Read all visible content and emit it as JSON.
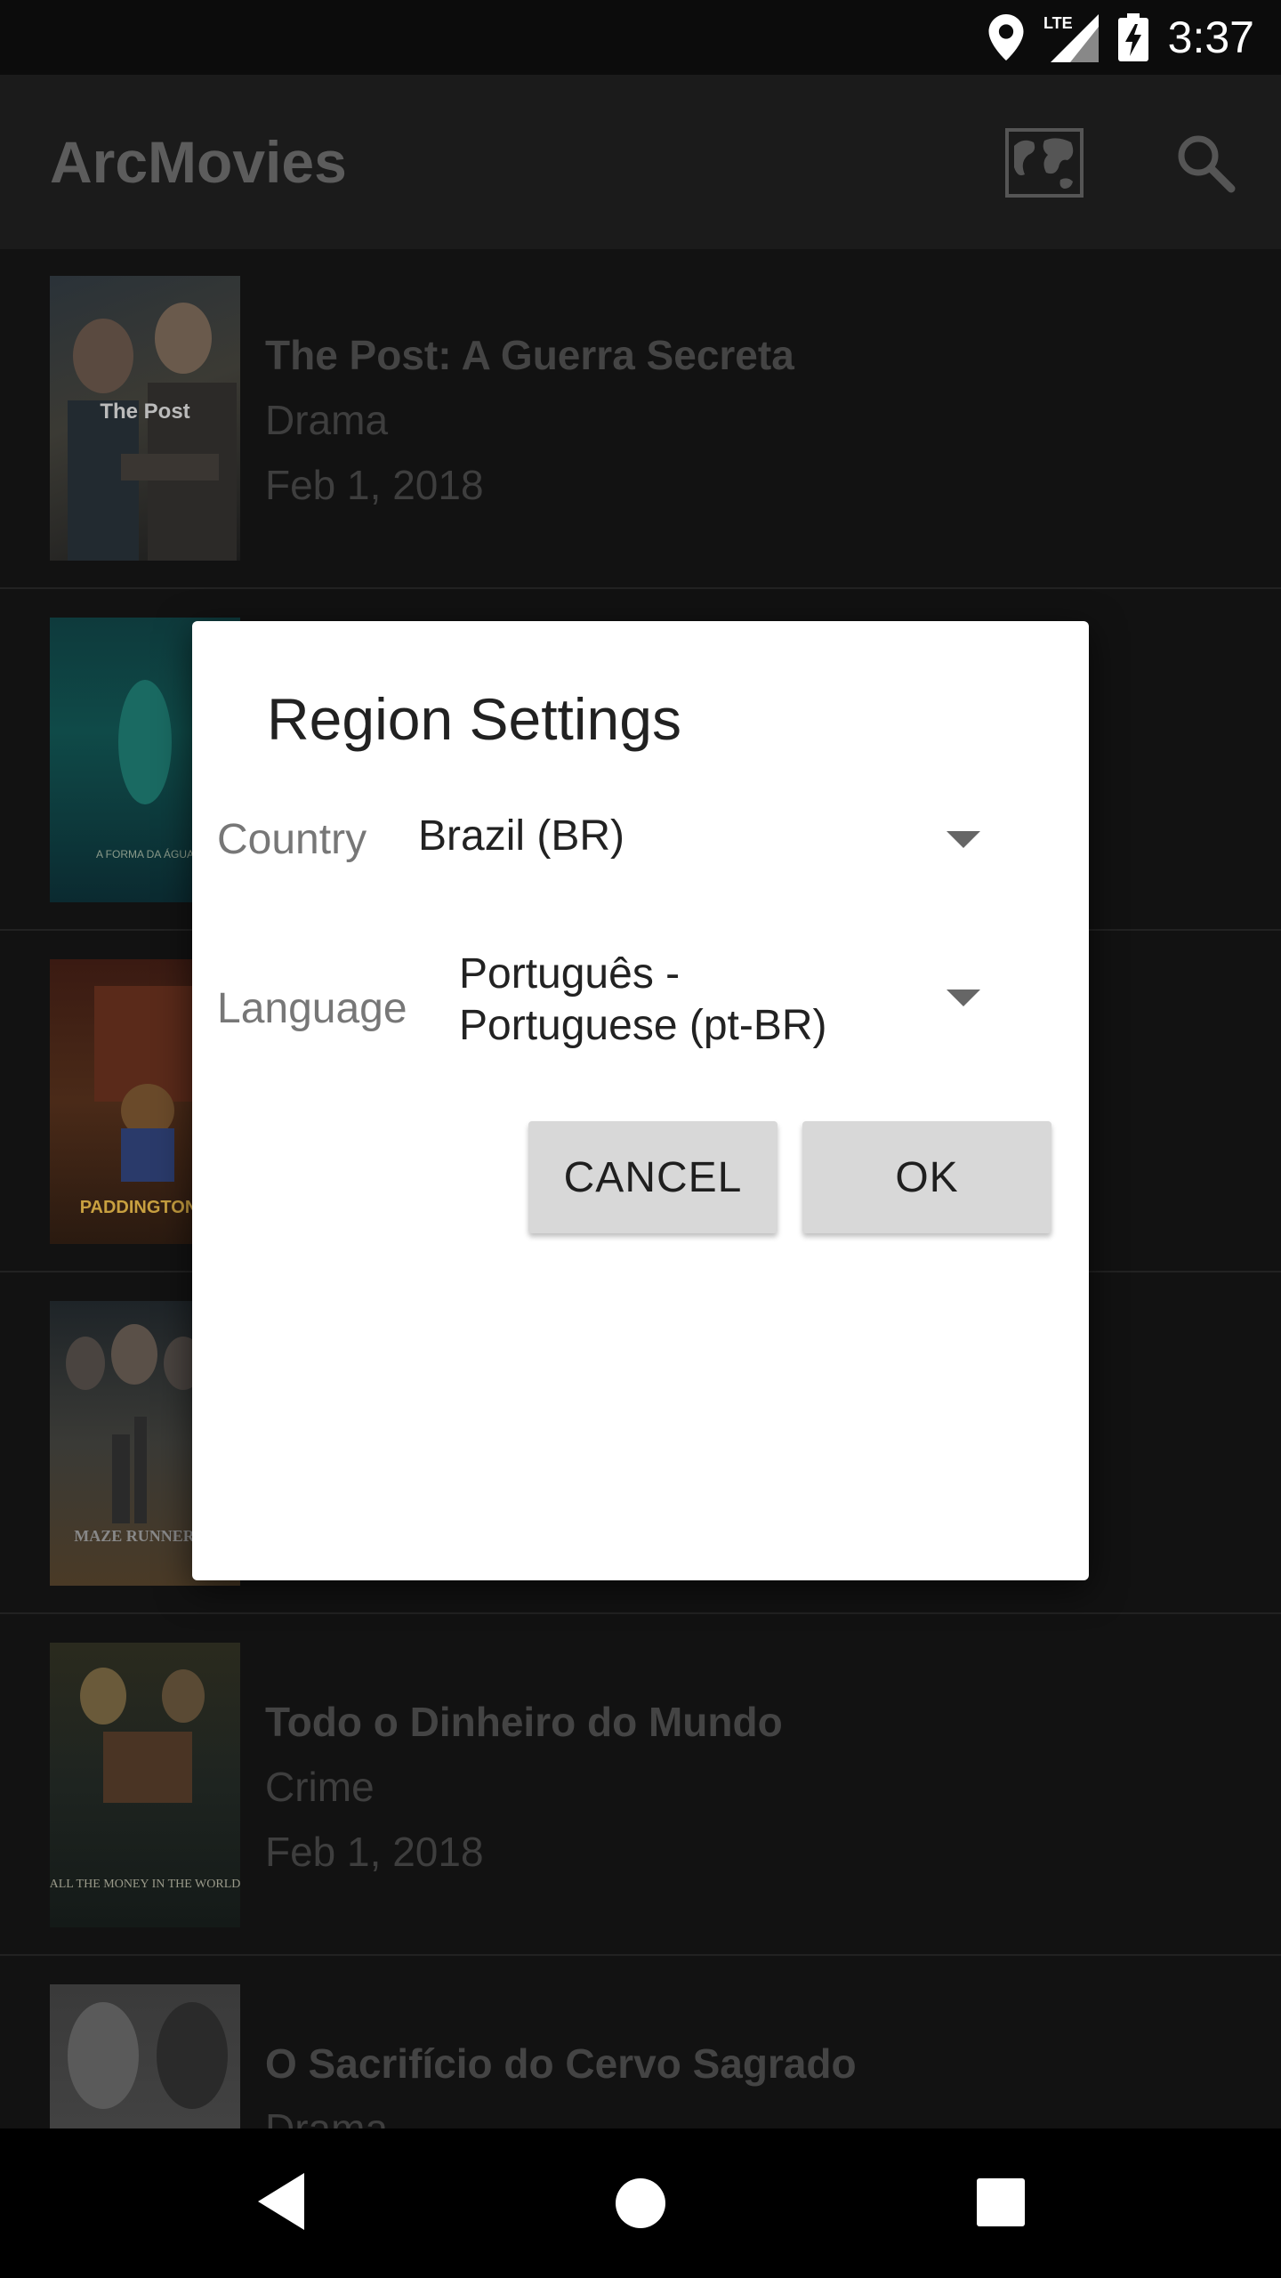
{
  "status_bar": {
    "time": "3:37",
    "network": "LTE"
  },
  "app_bar": {
    "title": "ArcMovies",
    "icons": [
      "map-icon",
      "search-icon"
    ]
  },
  "movies": [
    {
      "title": "The Post: A Guerra Secreta",
      "genre": "Drama",
      "date": "Feb 1, 2018",
      "poster_text": "The Post"
    },
    {
      "title": "",
      "genre": "",
      "date": "",
      "poster_text": "A FORMA DA ÁGUA"
    },
    {
      "title": "",
      "genre": "",
      "date": "",
      "poster_text": "PADDINGTON"
    },
    {
      "title": "",
      "genre": "",
      "date": "",
      "poster_text": "MAZE RUNNER"
    },
    {
      "title": "Todo o Dinheiro do Mundo",
      "genre": "Crime",
      "date": "Feb 1, 2018",
      "poster_text": "ALL THE MONEY IN THE WORLD"
    },
    {
      "title": "O Sacrifício do Cervo Sagrado",
      "genre": "Drama",
      "date": "",
      "poster_text": ""
    }
  ],
  "dialog": {
    "title": "Region Settings",
    "country_label": "Country",
    "country_value": "Brazil (BR)",
    "language_label": "Language",
    "language_value_line1": "Português -",
    "language_value_line2": "Portuguese (pt-BR)",
    "cancel_label": "CANCEL",
    "ok_label": "OK"
  },
  "nav_bar": {
    "icons": [
      "back-icon",
      "home-icon",
      "recents-icon"
    ]
  }
}
